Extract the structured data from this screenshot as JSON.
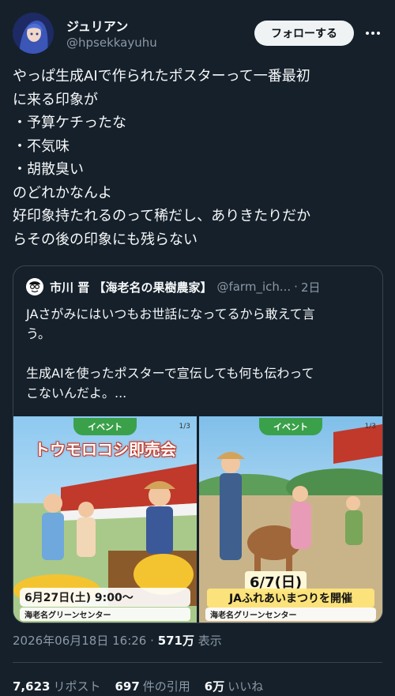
{
  "author": {
    "display_name": "ジュリアン",
    "handle": "@hpsekkayuhu",
    "follow_label": "フォローする",
    "more_icon": "more-horizontal-icon"
  },
  "tweet": {
    "text": "やっぱ生成AIで作られたポスターって一番最初\nに来る印象が\n・予算ケチったな\n・不気味\n・胡散臭い\nのどれかなんよ\n好印象持たれるのって稀だし、ありきたりだか\nらその後の印象にも残らない"
  },
  "quote": {
    "display_name": "市川 晋 【海老名の果樹農家】",
    "handle": "@farm_ich...",
    "time": "2日",
    "text": "JAさがみにはいつもお世話になってるから敢えて言\nう。\n\n生成AIを使ったポスターで宣伝しても何も伝わって\nこないんだよ。...",
    "posters": [
      {
        "count": "1/3",
        "tag": "イベント",
        "title": "トウモロコシ即売会",
        "date": "6月27日(土) 9:00〜",
        "venue": "海老名グリーンセンター"
      },
      {
        "count": "1/3",
        "tag": "イベント",
        "date": "6/7(日)",
        "title": "JAふれあいまつりを開催",
        "venue": "海老名グリーンセンター"
      }
    ]
  },
  "meta": {
    "timestamp": "2026年06月18日 16:26",
    "separator": "·",
    "views_count": "571万",
    "views_label": "表示"
  },
  "stats": {
    "reposts_count": "7,623",
    "reposts_label": "リポスト",
    "quotes_count": "697",
    "quotes_label": "件の引用",
    "likes_count": "6万",
    "likes_label": "いいね"
  },
  "colors": {
    "background": "#15202b",
    "text": "#f7f9f9",
    "secondary": "#8b98a5",
    "border": "#38444d",
    "follow_bg": "#eff3f4"
  }
}
